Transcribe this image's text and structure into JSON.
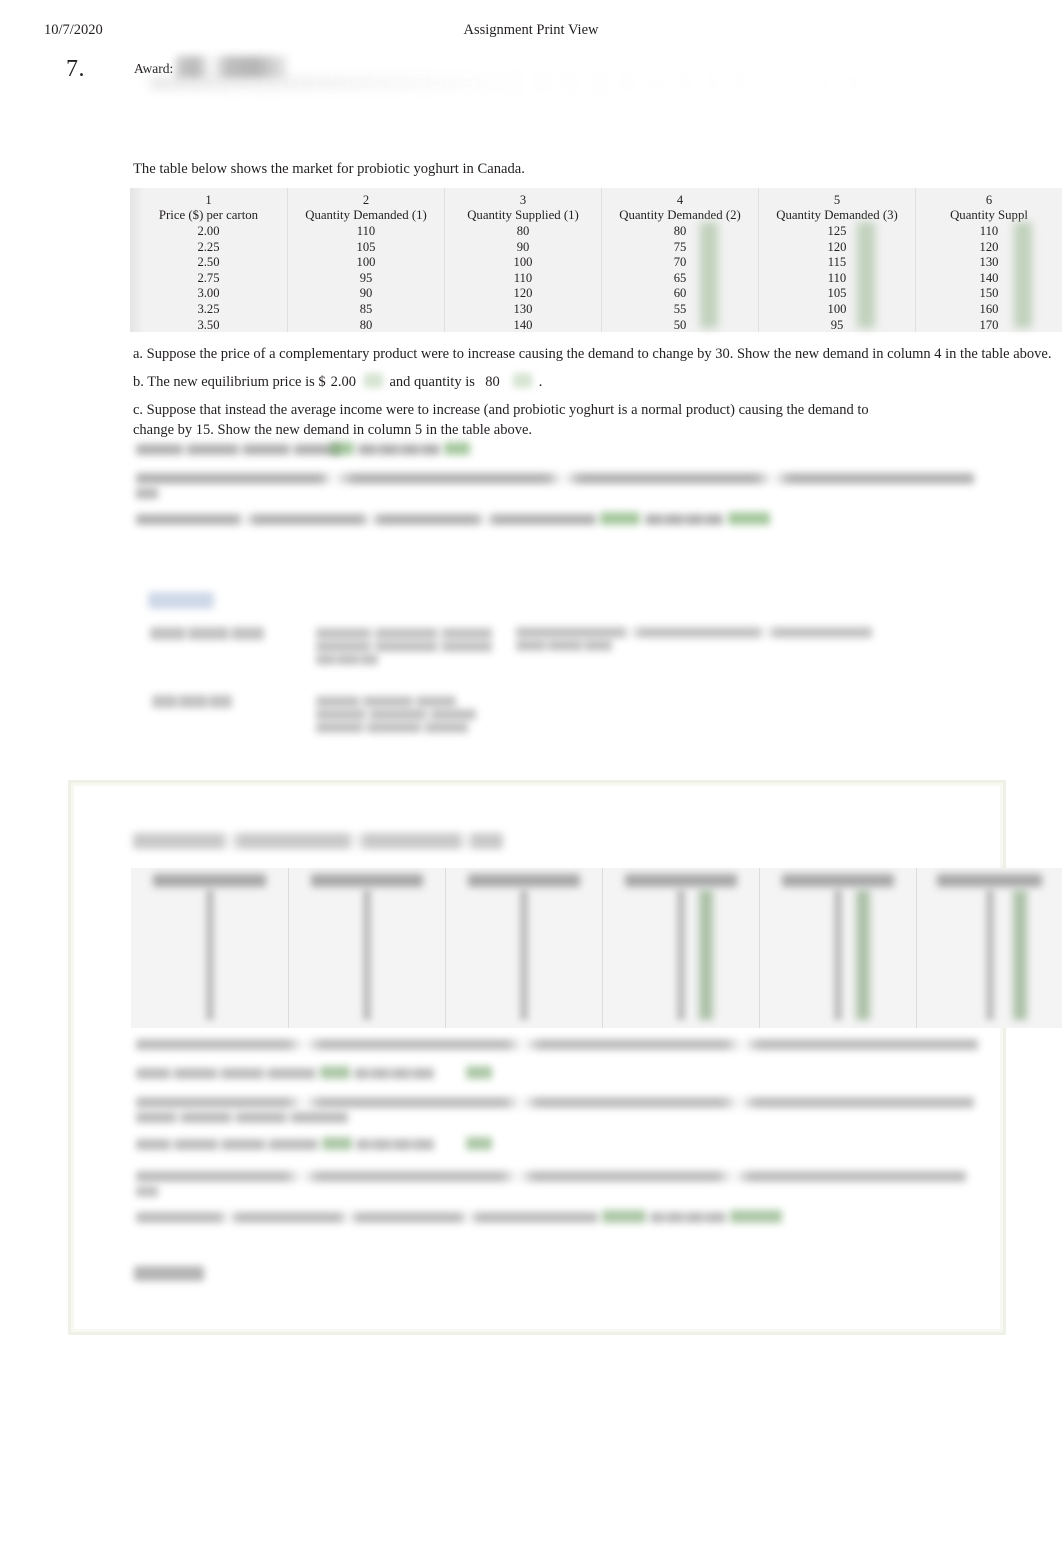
{
  "header": {
    "date": "10/7/2020",
    "title": "Assignment Print View"
  },
  "question": {
    "number": "7.",
    "award_label": "Award:",
    "award_value": ""
  },
  "intro": "The table below shows the market for probiotic yoghurt in Canada.",
  "table": {
    "columns": [
      {
        "number": "1",
        "header": "Price ($) per carton",
        "highlighted": false,
        "values": [
          "2.00",
          "2.25",
          "2.50",
          "2.75",
          "3.00",
          "3.25",
          "3.50"
        ]
      },
      {
        "number": "2",
        "header": "Quantity Demanded (1)",
        "highlighted": false,
        "values": [
          "110",
          "105",
          "100",
          "95",
          "90",
          "85",
          "80"
        ]
      },
      {
        "number": "3",
        "header": "Quantity Supplied (1)",
        "highlighted": false,
        "values": [
          "80",
          "90",
          "100",
          "110",
          "120",
          "130",
          "140"
        ]
      },
      {
        "number": "4",
        "header": "Quantity Demanded (2)",
        "highlighted": true,
        "values": [
          "80",
          "75",
          "70",
          "65",
          "60",
          "55",
          "50"
        ]
      },
      {
        "number": "5",
        "header": "Quantity Demanded (3)",
        "highlighted": true,
        "values": [
          "125",
          "120",
          "115",
          "110",
          "105",
          "100",
          "95"
        ]
      },
      {
        "number": "6",
        "header": "Quantity Suppl",
        "highlighted": true,
        "values": [
          "110",
          "120",
          "130",
          "140",
          "150",
          "160",
          "170"
        ]
      }
    ]
  },
  "parts": {
    "a": "a. Suppose the price of a complementary product were to increase causing the demand to change by 30. Show the new demand in column 4 in the table above.",
    "b_pre": "b. The new equilibrium price is $",
    "b_price": "2.00",
    "b_mid": "and quantity is",
    "b_quantity": "80",
    "b_post": ".",
    "c": "c. Suppose that instead the average income were to increase (and probiotic yoghurt is a normal product) causing the demand to change by 15. Show the new demand in column 5 in the table above."
  },
  "colors": {
    "answer_field": "#b8ccb3",
    "solution_border": "#eef2e6",
    "table_background": "#f2f2f2",
    "explanation_tab": "#a6b8d6"
  }
}
